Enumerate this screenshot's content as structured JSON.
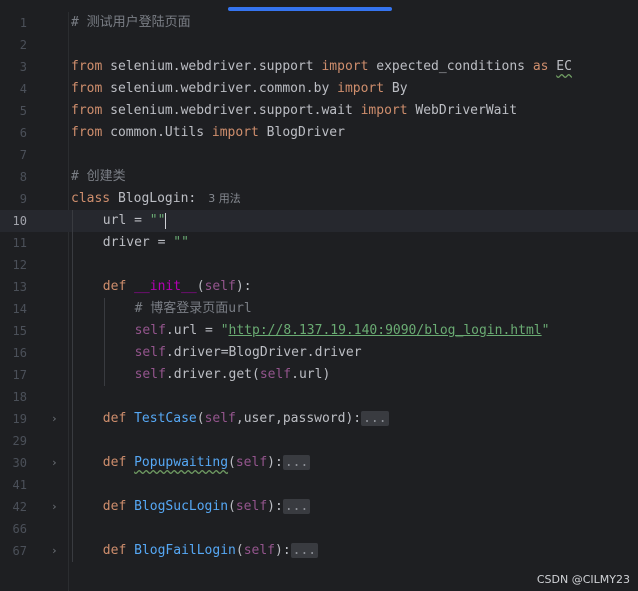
{
  "editor": {
    "watermark": "CSDN @CILMY23",
    "lines": [
      {
        "no": "1",
        "current": false,
        "fold": false,
        "indent": 0,
        "tokens": [
          [
            "cmt",
            "# 测试用户登陆页面"
          ]
        ]
      },
      {
        "no": "2",
        "current": false,
        "fold": false,
        "indent": 0,
        "tokens": []
      },
      {
        "no": "3",
        "current": false,
        "fold": false,
        "indent": 0,
        "tokens": [
          [
            "kw",
            "from"
          ],
          [
            "plain",
            " selenium.webdriver.support "
          ],
          [
            "kw",
            "import"
          ],
          [
            "plain",
            " expected_conditions "
          ],
          [
            "kw",
            "as"
          ],
          [
            "plain",
            " "
          ],
          [
            "plain warn",
            "EC"
          ]
        ]
      },
      {
        "no": "4",
        "current": false,
        "fold": false,
        "indent": 0,
        "tokens": [
          [
            "kw",
            "from"
          ],
          [
            "plain",
            " selenium.webdriver.common.by "
          ],
          [
            "kw",
            "import"
          ],
          [
            "plain",
            " By"
          ]
        ]
      },
      {
        "no": "5",
        "current": false,
        "fold": false,
        "indent": 0,
        "tokens": [
          [
            "kw",
            "from"
          ],
          [
            "plain",
            " selenium.webdriver.support.wait "
          ],
          [
            "kw",
            "import"
          ],
          [
            "plain",
            " WebDriverWait"
          ]
        ]
      },
      {
        "no": "6",
        "current": false,
        "fold": false,
        "indent": 0,
        "tokens": [
          [
            "kw",
            "from"
          ],
          [
            "plain",
            " common.Utils "
          ],
          [
            "kw",
            "import"
          ],
          [
            "plain",
            " BlogDriver"
          ]
        ]
      },
      {
        "no": "7",
        "current": false,
        "fold": false,
        "indent": 0,
        "tokens": []
      },
      {
        "no": "8",
        "current": false,
        "fold": false,
        "indent": 0,
        "tokens": [
          [
            "cmt",
            "# 创建类"
          ]
        ]
      },
      {
        "no": "9",
        "current": false,
        "fold": false,
        "indent": 0,
        "tokens": [
          [
            "kw",
            "class"
          ],
          [
            "plain",
            " BlogLogin:"
          ],
          [
            "hint",
            "3 用法"
          ]
        ]
      },
      {
        "no": "10",
        "current": true,
        "fold": false,
        "indent": 1,
        "tokens": [
          [
            "plain",
            "url = "
          ],
          [
            "str",
            "\"\""
          ],
          [
            "caret",
            ""
          ]
        ]
      },
      {
        "no": "11",
        "current": false,
        "fold": false,
        "indent": 1,
        "tokens": [
          [
            "plain",
            "driver = "
          ],
          [
            "str",
            "\"\""
          ]
        ]
      },
      {
        "no": "12",
        "current": false,
        "fold": false,
        "indent": 0,
        "tokens": []
      },
      {
        "no": "13",
        "current": false,
        "fold": false,
        "indent": 1,
        "tokens": [
          [
            "kw",
            "def"
          ],
          [
            "plain",
            " "
          ],
          [
            "dunder",
            "__init__"
          ],
          [
            "plain",
            "("
          ],
          [
            "self",
            "self"
          ],
          [
            "plain",
            "):"
          ]
        ]
      },
      {
        "no": "14",
        "current": false,
        "fold": false,
        "indent": 2,
        "tokens": [
          [
            "cmt",
            "# 博客登录页面url"
          ]
        ]
      },
      {
        "no": "15",
        "current": false,
        "fold": false,
        "indent": 2,
        "tokens": [
          [
            "self",
            "self"
          ],
          [
            "plain",
            ".url = "
          ],
          [
            "str",
            "\""
          ],
          [
            "link",
            "http://8.137.19.140:9090/blog_login.html"
          ],
          [
            "str",
            "\""
          ]
        ]
      },
      {
        "no": "16",
        "current": false,
        "fold": false,
        "indent": 2,
        "tokens": [
          [
            "self",
            "self"
          ],
          [
            "plain",
            ".driver=BlogDriver.driver"
          ]
        ]
      },
      {
        "no": "17",
        "current": false,
        "fold": false,
        "indent": 2,
        "tokens": [
          [
            "self",
            "self"
          ],
          [
            "plain",
            ".driver.get("
          ],
          [
            "self",
            "self"
          ],
          [
            "plain",
            ".url)"
          ]
        ]
      },
      {
        "no": "18",
        "current": false,
        "fold": false,
        "indent": 0,
        "tokens": []
      },
      {
        "no": "19",
        "current": false,
        "fold": true,
        "indent": 1,
        "tokens": [
          [
            "kw",
            "def"
          ],
          [
            "plain",
            " "
          ],
          [
            "fn",
            "TestCase"
          ],
          [
            "plain",
            "("
          ],
          [
            "self",
            "self"
          ],
          [
            "plain",
            ",user,password):"
          ],
          [
            "collapsed",
            "..."
          ]
        ]
      },
      {
        "no": "29",
        "current": false,
        "fold": false,
        "indent": 0,
        "tokens": []
      },
      {
        "no": "30",
        "current": false,
        "fold": true,
        "indent": 1,
        "tokens": [
          [
            "kw",
            "def"
          ],
          [
            "plain",
            " "
          ],
          [
            "fn warn",
            "Popupwaiting"
          ],
          [
            "plain",
            "("
          ],
          [
            "self",
            "self"
          ],
          [
            "plain",
            "):"
          ],
          [
            "collapsed",
            "..."
          ]
        ]
      },
      {
        "no": "41",
        "current": false,
        "fold": false,
        "indent": 0,
        "tokens": []
      },
      {
        "no": "42",
        "current": false,
        "fold": true,
        "indent": 1,
        "tokens": [
          [
            "kw",
            "def"
          ],
          [
            "plain",
            " "
          ],
          [
            "fn",
            "BlogSucLogin"
          ],
          [
            "plain",
            "("
          ],
          [
            "self",
            "self"
          ],
          [
            "plain",
            "):"
          ],
          [
            "collapsed",
            "..."
          ]
        ]
      },
      {
        "no": "66",
        "current": false,
        "fold": false,
        "indent": 0,
        "tokens": []
      },
      {
        "no": "67",
        "current": false,
        "fold": true,
        "indent": 1,
        "tokens": [
          [
            "kw",
            "def"
          ],
          [
            "plain",
            " "
          ],
          [
            "fn",
            "BlogFailLogin"
          ],
          [
            "plain",
            "("
          ],
          [
            "self",
            "self"
          ],
          [
            "plain",
            "):"
          ],
          [
            "collapsed",
            "..."
          ]
        ]
      }
    ]
  }
}
